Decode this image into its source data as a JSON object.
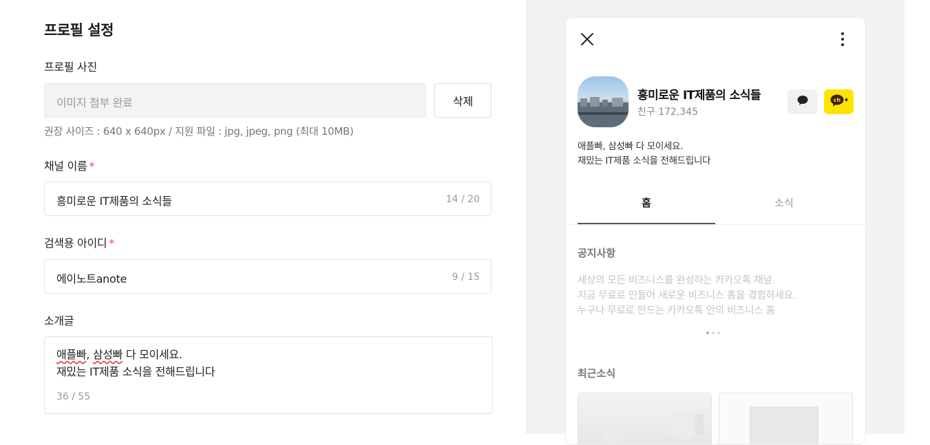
{
  "form": {
    "title": "프로필 설정",
    "photo": {
      "label": "프로필 사진",
      "value": "이미지 첨부 완료",
      "delete_label": "삭제",
      "hint": "권장 사이즈 : 640 x 640px / 지원 파일 : jpg, jpeg, png (최대 10MB)"
    },
    "channel_name": {
      "label": "채널 이름",
      "required_mark": "*",
      "value": "흥미로운 IT제품의 소식들",
      "count": "14 / 20"
    },
    "search_id": {
      "label": "검색용 아이디",
      "required_mark": "*",
      "value": "에이노트anote",
      "count": "9 / 15"
    },
    "intro": {
      "label": "소개글",
      "line1_misspelled": "애플빠",
      "line1_sep": ", ",
      "line1_misspelled2": "삼성빠",
      "line1_rest": " 다 모이세요.",
      "line2": "재밌는 IT제품 소식을 전해드립니다",
      "count": "36 / 55"
    }
  },
  "preview": {
    "channel_name": "흥미로운 IT제품의 소식들",
    "friends": "친구 172,345",
    "description_line1": "애플빠, 삼성빠 다 모이세요.",
    "description_line2": "재밌는 IT제품 소식을 전해드립니다",
    "tabs": [
      "홈",
      "소식"
    ],
    "notice_title": "공지사항",
    "notice_lines": [
      "세상의 모든 비즈니스를 완성하는 카카오톡 채널.",
      "지금 무료로 만들어 새로운 비즈니스 홈을 경험하세요.",
      "누구나 무료로 만드는 카카오톡 안의 비즈니스 홈"
    ],
    "recent_title": "최근소식",
    "icons": {
      "close": "close-icon",
      "more": "more-vertical-icon",
      "chat": "chat-bubble-icon",
      "channel_add": "channel-add-icon"
    },
    "colors": {
      "accent": "#fee500",
      "required": "#e8483f"
    }
  }
}
